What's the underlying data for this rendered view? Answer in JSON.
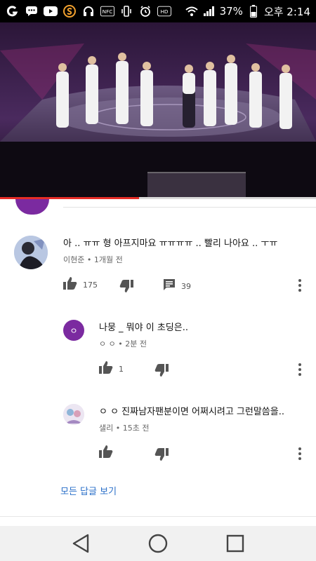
{
  "status_bar": {
    "icons": [
      "g-logo-icon",
      "chat-icon",
      "youtube-icon",
      "s-app-icon",
      "headset-icon",
      "nfc-icon",
      "vibrate-icon",
      "alarm-icon",
      "hd-icon",
      "wifi-icon",
      "signal-icon"
    ],
    "nfc_label": "NFC",
    "hd_label": "HD",
    "battery": "37%",
    "time": "오후 2:14"
  },
  "video": {
    "progress_fraction": 0.44,
    "accent": "#e52d27"
  },
  "comments": [
    {
      "text": "아 .. ㅠㅠ 형 아프지마요 ㅠㅠㅠㅠ .. 빨리 나아요 .. ㅜㅠ",
      "meta": "이현준 • 1개월 전",
      "likes": "175",
      "replies": "39"
    }
  ],
  "replies": [
    {
      "avatar_initial": "ㅇ",
      "text": "나뭉 _ 뭐야 이 초딩은..",
      "meta": "ㅇ ㅇ • 2분 전",
      "likes": "1"
    },
    {
      "text": "ㅇ ㅇ 진짜남자팬분이면 어쩌시려고 그런말씀을..",
      "meta": "샐리 • 15초 전",
      "likes": ""
    }
  ],
  "show_all_replies": "모든 답글 보기",
  "colors": {
    "link": "#2a6fc9",
    "avatar_purple": "#7b2aa0",
    "progress": "#e52d27"
  }
}
